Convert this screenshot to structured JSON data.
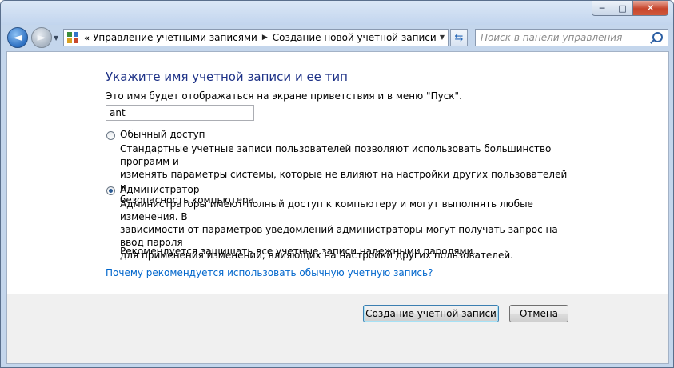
{
  "window": {
    "caption": {
      "minimize": "─",
      "maximize": "□",
      "close": "✕"
    }
  },
  "nav": {
    "back_glyph": "◄",
    "forward_glyph": "►",
    "history_glyph": "▼"
  },
  "address": {
    "chevron": "«",
    "breadcrumbs": [
      "Управление учетными записями",
      "Создание новой учетной записи"
    ],
    "separator": "▶",
    "dropdown_glyph": "▼",
    "refresh_glyph": "⇆"
  },
  "search": {
    "placeholder": "Поиск в панели управления"
  },
  "main": {
    "heading": "Укажите имя учетной записи и ее тип",
    "prompt": "Это имя будет отображаться на экране приветствия и в меню \"Пуск\".",
    "name_value": "ant",
    "options": [
      {
        "label": "Обычный доступ",
        "checked": false,
        "description_lines": [
          "Стандартные учетные записи пользователей позволяют использовать большинство программ и",
          "изменять параметры системы, которые не влияют на настройки других пользователей и",
          "безопасность компьютера."
        ]
      },
      {
        "label": "Администратор",
        "checked": true,
        "description_lines": [
          "Администраторы имеют полный доступ к компьютеру и могут выполнять любые изменения. В",
          "зависимости от параметров уведомлений администраторы могут получать запрос на ввод пароля",
          "для применения изменений, влияющих на настройки других пользователей."
        ],
        "note": "Рекомендуется защищать все учетные записи надежными паролями."
      }
    ],
    "help_link": "Почему рекомендуется использовать обычную учетную запись?"
  },
  "footer": {
    "create_label": "Создание учетной записи",
    "cancel_label": "Отмена"
  }
}
